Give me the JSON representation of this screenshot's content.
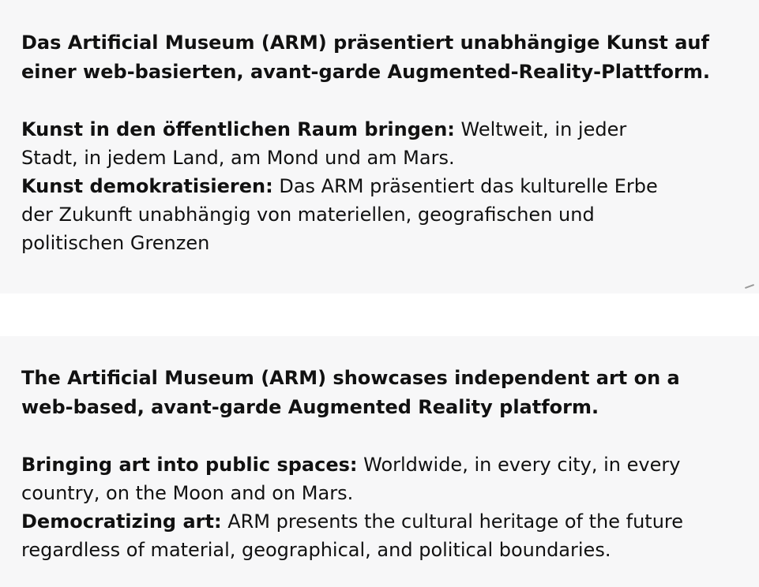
{
  "sections": {
    "de": {
      "headline": "Das Artificial Museum (ARM) präsentiert unabhängige Kunst auf einer web-basierten, avant-garde Augmented-Reality-Plattform.",
      "features": [
        {
          "title": "Kunst in den öffentlichen Raum bringen:",
          "text": " Weltweit, in jeder Stadt, in jedem Land, am Mond und am Mars."
        },
        {
          "title": "Kunst demokratisieren:",
          "text": " Das ARM präsentiert das kulturelle Erbe der Zukunft unabhängig von materiellen, geografischen und politischen Grenzen"
        }
      ]
    },
    "en": {
      "headline": "The Artificial Museum (ARM) showcases independent art on a web-based, avant-garde Augmented Reality platform.",
      "features": [
        {
          "title": "Bringing art into public spaces:",
          "text": " Worldwide, in every city, in every country, on the Moon and on Mars."
        },
        {
          "title": "Democratizing art:",
          "text": " ARM presents the cultural heritage of the future regardless of material, geographical, and political boundaries."
        }
      ]
    }
  }
}
